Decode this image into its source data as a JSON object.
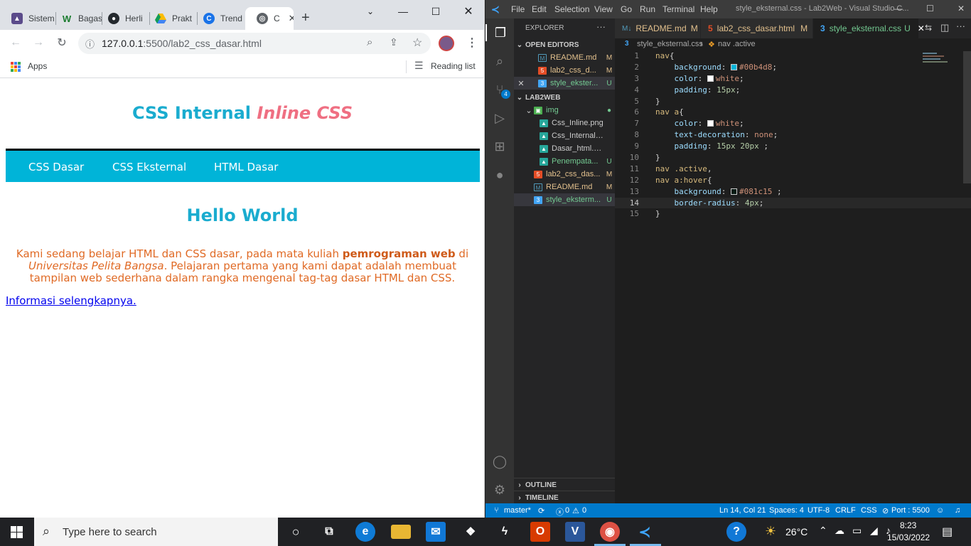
{
  "browser": {
    "tabs": [
      {
        "title": "Sistem",
        "icon": "university-icon",
        "color": "#5b4b8a"
      },
      {
        "title": "Bagas",
        "icon": "w-icon",
        "color": "#1b7c2f"
      },
      {
        "title": "Herli",
        "icon": "github-icon",
        "color": "#24292e"
      },
      {
        "title": "Prakt",
        "icon": "drive-icon",
        "color": "#fbbc04"
      },
      {
        "title": "Trend",
        "icon": "c-icon",
        "color": "#1a73e8"
      },
      {
        "title": "C",
        "icon": "globe-icon",
        "color": "#5f6368"
      }
    ],
    "new_tab_label": "+",
    "url_host": "127.0.0.1",
    "url_rest": ":5500/lab2_css_dasar.html",
    "apps_label": "Apps",
    "reading_list_label": "Reading list"
  },
  "webpage": {
    "title_plain": "CSS Internal",
    "title_italic": "Inline CSS",
    "nav": [
      "CSS Dasar",
      "CSS Eksternal",
      "HTML Dasar"
    ],
    "heading": "Hello World",
    "para_1": "Kami sedang belajar HTML dan CSS dasar, pada mata kuliah ",
    "para_bold": "pemrograman web",
    "para_2": " di ",
    "para_italic": "Universitas Pelita Bangsa",
    "para_3": ". Pelajaran pertama yang kami dapat adalah membuat tampilan web sederhana dalam rangka mengenal tag-tag dasar HTML dan CSS.",
    "link": "Informasi selengkapnya."
  },
  "vscode": {
    "menu": [
      "File",
      "Edit",
      "Selection",
      "View",
      "Go",
      "Run",
      "Terminal",
      "Help"
    ],
    "window_title": "style_eksternal.css - Lab2Web - Visual Studio C...",
    "explorer_label": "EXPLORER",
    "open_editors_label": "OPEN EDITORS",
    "open_editors": [
      {
        "name": "README.md",
        "status": "M",
        "type": "md"
      },
      {
        "name": "lab2_css_d...",
        "status": "M",
        "type": "html"
      },
      {
        "name": "style_ekster...",
        "status": "U",
        "type": "css"
      }
    ],
    "folder_label": "LAB2WEB",
    "tree": [
      {
        "name": "img",
        "status": "●",
        "type": "folder",
        "indent": 1
      },
      {
        "name": "Css_Inline.png",
        "status": "",
        "type": "img",
        "indent": 2
      },
      {
        "name": "Css_Internal.png",
        "status": "",
        "type": "img",
        "indent": 2
      },
      {
        "name": "Dasar_html.png",
        "status": "",
        "type": "img",
        "indent": 2
      },
      {
        "name": "Penempata...",
        "status": "U",
        "type": "img",
        "indent": 2
      },
      {
        "name": "lab2_css_das...",
        "status": "M",
        "type": "html",
        "indent": 1
      },
      {
        "name": "README.md",
        "status": "M",
        "type": "md",
        "indent": 1
      },
      {
        "name": "style_eksterm...",
        "status": "U",
        "type": "css",
        "indent": 1
      }
    ],
    "outline_label": "OUTLINE",
    "timeline_label": "TIMELINE",
    "editor_tabs": [
      {
        "name": "README.md",
        "status": "M"
      },
      {
        "name": "lab2_css_dasar.html",
        "status": "M"
      },
      {
        "name": "style_eksternal.css",
        "status": "U"
      }
    ],
    "breadcrumb_file": "style_eksternal.css",
    "breadcrumb_symbol": "nav .active",
    "status": {
      "branch": "master*",
      "problems": "0",
      "warnings": "0",
      "position": "Ln 14, Col 21",
      "spaces": "Spaces: 4",
      "encoding": "UTF-8",
      "eol": "CRLF",
      "language": "CSS",
      "port": "Port : 5500"
    }
  },
  "taskbar": {
    "search_placeholder": "Type here to search",
    "weather": "26°C",
    "time": "8:23",
    "date": "15/03/2022"
  }
}
